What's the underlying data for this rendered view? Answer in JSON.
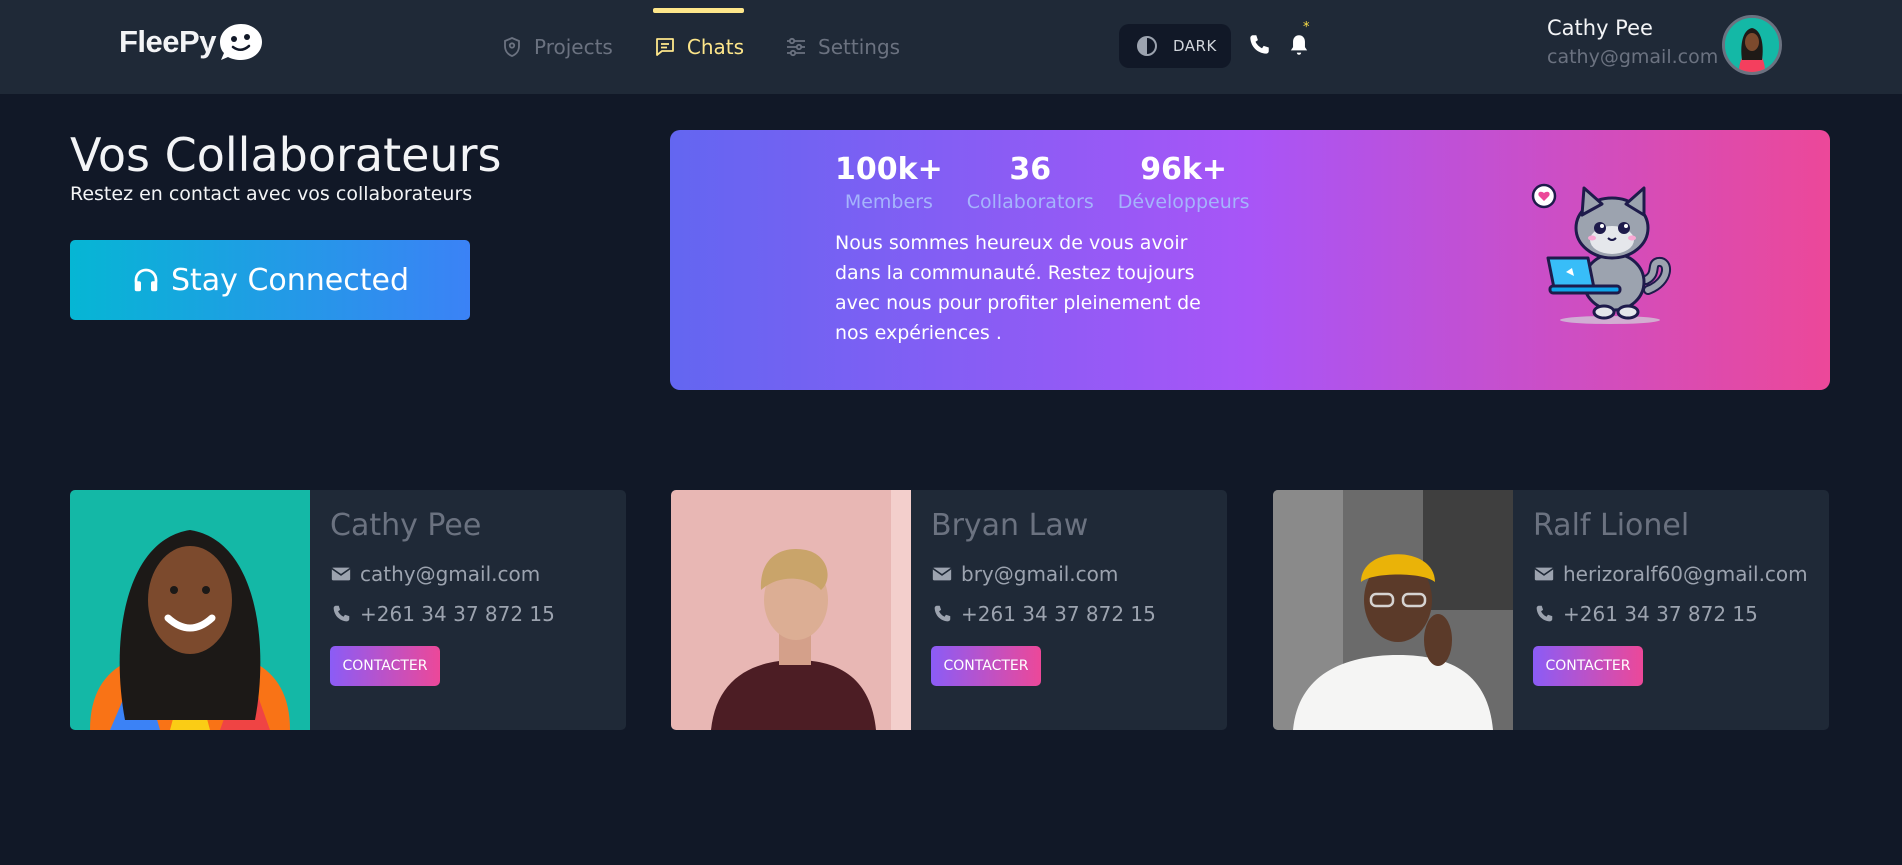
{
  "header": {
    "logo_text": "FleePy",
    "nav": [
      {
        "label": "Projects",
        "icon": "shield-pin-icon",
        "active": false
      },
      {
        "label": "Chats",
        "icon": "chat-icon",
        "active": true
      },
      {
        "label": "Settings",
        "icon": "sliders-icon",
        "active": false
      }
    ],
    "theme_label": "DARK",
    "notification_mark": "*",
    "user": {
      "name": "Cathy Pee",
      "email": "cathy@gmail.com"
    }
  },
  "hero": {
    "title": "Vos Collaborateurs",
    "subtitle": "Restez en contact avec vos collaborateurs",
    "cta_label": "Stay Connected"
  },
  "banner": {
    "stats": [
      {
        "value": "100k+",
        "label": "Members"
      },
      {
        "value": "36",
        "label": "Collaborators"
      },
      {
        "value": "96k+",
        "label": "Développeurs"
      }
    ],
    "text": "Nous sommes heureux de vous avoir dans la communauté. Restez toujours avec nous pour profiter pleinement de nos expériences ."
  },
  "cards": [
    {
      "name": "Cathy Pee",
      "email": "cathy@gmail.com",
      "phone": "+261 34 37 872 15",
      "button": "CONTACTER"
    },
    {
      "name": "Bryan Law",
      "email": "bry@gmail.com",
      "phone": "+261 34 37 872 15",
      "button": "CONTACTER"
    },
    {
      "name": "Ralf Lionel",
      "email": "herizoralf60@gmail.com",
      "phone": "+261 34 37 872 15",
      "button": "CONTACTER"
    }
  ],
  "colors": {
    "background": "#111827",
    "header": "#1f2937",
    "accent_yellow": "#fde68a",
    "banner_gradient": [
      "#6366f1",
      "#a855f7",
      "#ec4899"
    ],
    "cta_gradient": [
      "#06b6d4",
      "#3b82f6"
    ]
  }
}
